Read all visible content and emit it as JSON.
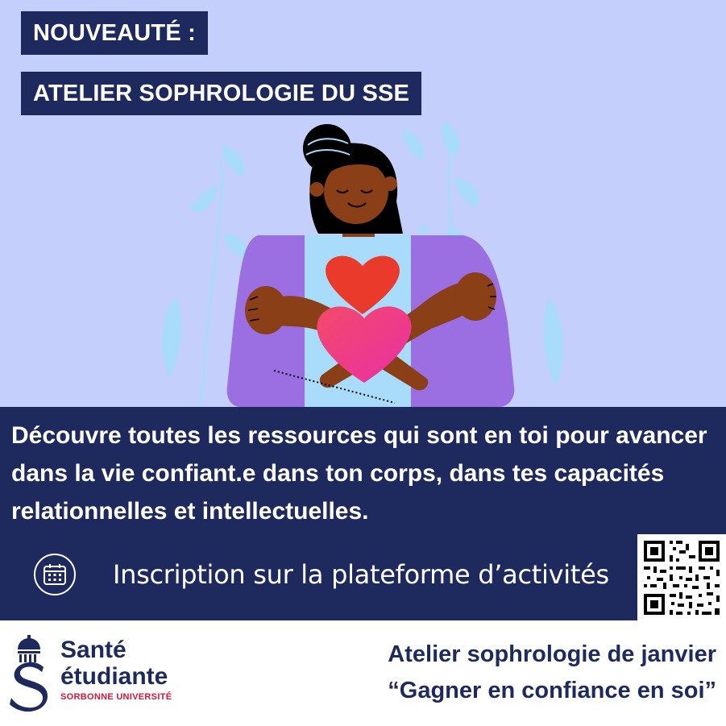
{
  "header": {
    "tag_new": "NOUVEAUTÉ :",
    "tag_title": "ATELIER SOPHROLOGIE DU SSE"
  },
  "info": {
    "description": "Découvre toutes les ressources qui sont en toi pour avancer dans la vie confiant.e dans ton corps, dans tes capacités relationnelles et intellectuelles.",
    "signup_text": "Inscription sur la plateforme d’activités",
    "signup_icon": "calendar-icon"
  },
  "footer": {
    "logo_line1": "Santé",
    "logo_line2": "étudiante",
    "logo_sub": "SORBONNE UNIVERSITÉ",
    "event_line1": "Atelier sophrologie de janvier",
    "event_line2": "“Gagner en confiance en soi”"
  },
  "colors": {
    "hero_background": "#c4cffb",
    "navy": "#1e2a5e",
    "brand_red": "#d5173b",
    "sweater_purple": "#9b6fe2",
    "heart_red": "#ea3a2c",
    "heart_pink": "#f23c7d"
  }
}
